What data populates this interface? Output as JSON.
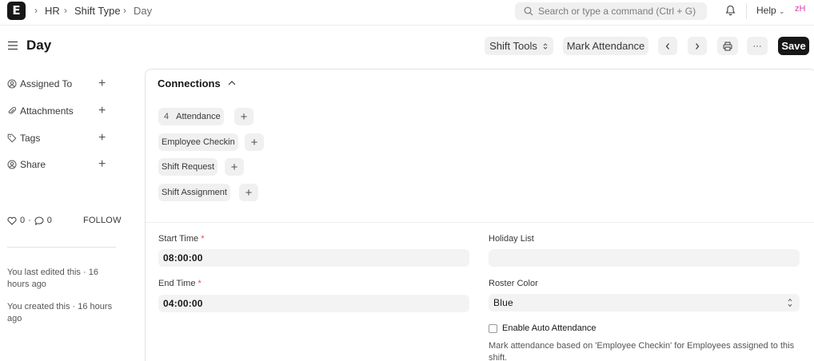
{
  "navbar": {
    "logo_letter": "E",
    "breadcrumbs": [
      "HR",
      "Shift Type",
      "Day"
    ],
    "search_placeholder": "Search or type a command (Ctrl + G)",
    "help_label": "Help",
    "avatar_initials": "zH"
  },
  "header": {
    "title": "Day",
    "shift_tools_label": "Shift Tools",
    "mark_attendance_label": "Mark Attendance",
    "more_label": "···",
    "save_label": "Save"
  },
  "sidebar": {
    "items": [
      {
        "label": "Assigned To",
        "icon": "user-add-icon"
      },
      {
        "label": "Attachments",
        "icon": "paperclip-icon"
      },
      {
        "label": "Tags",
        "icon": "tag-icon"
      },
      {
        "label": "Share",
        "icon": "share-icon"
      }
    ],
    "likes_count": "0",
    "comments_count": "0",
    "separator": "·",
    "follow_label": "FOLLOW",
    "last_edited": "You last edited this · 16 hours ago",
    "created": "You created this · 16 hours ago"
  },
  "connections": {
    "title": "Connections",
    "links": [
      {
        "count": "4",
        "label": "Attendance"
      },
      {
        "count": "",
        "label": "Employee Checkin"
      },
      {
        "count": "",
        "label": "Shift Request"
      },
      {
        "count": "",
        "label": "Shift Assignment"
      }
    ]
  },
  "form": {
    "start_time_label": "Start Time",
    "start_time_value": "08:00:00",
    "end_time_label": "End Time",
    "end_time_value": "04:00:00",
    "required_mark": "*",
    "holiday_list_label": "Holiday List",
    "holiday_list_value": "",
    "roster_color_label": "Roster Color",
    "roster_color_value": "Blue",
    "auto_attendance_label": "Enable Auto Attendance",
    "auto_attendance_checked": false,
    "auto_attendance_description": "Mark attendance based on 'Employee Checkin' for Employees assigned to this shift."
  },
  "colors": {
    "primary_button": "#171717",
    "avatar_text": "#d93fae",
    "required": "#e24c4c"
  }
}
